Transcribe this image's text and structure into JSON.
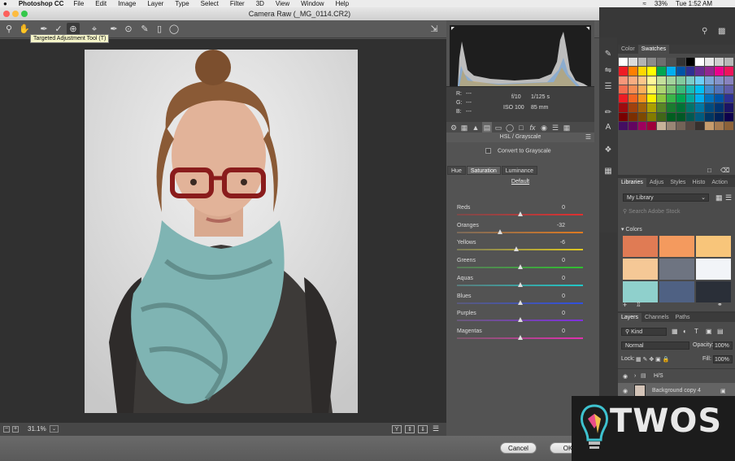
{
  "menubar": {
    "app": "Photoshop CC",
    "items": [
      "File",
      "Edit",
      "Image",
      "Layer",
      "Type",
      "Select",
      "Filter",
      "3D",
      "View",
      "Window",
      "Help"
    ],
    "battery": "33%",
    "clock": "Tue 1:52 AM"
  },
  "window": {
    "title": "Camera Raw (_MG_0114.CR2)"
  },
  "toolbar": {
    "tooltip": "Targeted Adjustment Tool (T)"
  },
  "zoom": {
    "value": "31.1%"
  },
  "buttons": {
    "cancel": "Cancel",
    "ok": "OK"
  },
  "info": {
    "r_label": "R:",
    "g_label": "G:",
    "b_label": "B:",
    "r": "---",
    "g": "---",
    "b": "---",
    "aperture": "f/10",
    "shutter": "1/125 s",
    "iso": "ISO 100",
    "focal": "85 mm"
  },
  "hsl": {
    "title": "HSL / Grayscale",
    "convert_label": "Convert to Grayscale",
    "tabs": [
      "Hue",
      "Saturation",
      "Luminance"
    ],
    "selected_tab": "Saturation",
    "default_label": "Default",
    "sliders": [
      {
        "label": "Reds",
        "value": "0"
      },
      {
        "label": "Oranges",
        "value": "-32"
      },
      {
        "label": "Yellows",
        "value": "-6"
      },
      {
        "label": "Greens",
        "value": "0"
      },
      {
        "label": "Aquas",
        "value": "0"
      },
      {
        "label": "Blues",
        "value": "0"
      },
      {
        "label": "Purples",
        "value": "0"
      },
      {
        "label": "Magentas",
        "value": "0"
      }
    ]
  },
  "swatches": {
    "tabs": [
      "Color",
      "Swatches"
    ],
    "selected_tab": "Swatches",
    "colors": [
      "#ffffff",
      "#dcdcdc",
      "#b4b4b4",
      "#8c8c8c",
      "#6e6e6e",
      "#505050",
      "#323232",
      "#000000",
      "#ffffff",
      "#e8e8e8",
      "#d0d0d0",
      "#b8b8b8",
      "#ee1c24",
      "#ff7f00",
      "#ffd700",
      "#ffff00",
      "#00a651",
      "#00aeef",
      "#0054a6",
      "#2e3192",
      "#662d91",
      "#92278f",
      "#ec008c",
      "#ed145b",
      "#f7977a",
      "#f9ad81",
      "#fdc68a",
      "#fff79a",
      "#c4df9b",
      "#a3d39c",
      "#82ca9d",
      "#7bcdc8",
      "#6ecff6",
      "#7ea7d8",
      "#8493ca",
      "#8882be",
      "#f26c4f",
      "#f68e55",
      "#fbaf5c",
      "#fff467",
      "#acd372",
      "#7cc576",
      "#3bb878",
      "#1abbb4",
      "#00bff3",
      "#438ccb",
      "#5574b9",
      "#605ca8",
      "#ed1c24",
      "#f26522",
      "#f7941d",
      "#fff200",
      "#8dc73f",
      "#39b54a",
      "#00a651",
      "#00a99d",
      "#00aeef",
      "#0072bc",
      "#0054a6",
      "#2e3192",
      "#9e0b0f",
      "#a0410d",
      "#a36209",
      "#aba000",
      "#598527",
      "#1a7b30",
      "#007236",
      "#00746b",
      "#0076a3",
      "#004b80",
      "#003471",
      "#1b1464",
      "#790000",
      "#7b2e00",
      "#7d4900",
      "#827b00",
      "#406618",
      "#005e20",
      "#005826",
      "#005952",
      "#005b7f",
      "#003663",
      "#002157",
      "#0d004c",
      "#440e62",
      "#630460",
      "#9e005d",
      "#9e0039",
      "#c7b299",
      "#998675",
      "#736357",
      "#534741",
      "#37302d",
      "#c69c6d",
      "#a67c52",
      "#8c6239"
    ]
  },
  "libraries": {
    "tabs": [
      "Libraries",
      "Adjus",
      "Styles",
      "Histo",
      "Action"
    ],
    "selected_tab": "Libraries",
    "library": "My Library",
    "search_placeholder": "Search Adobe Stock",
    "colors_label": "Colors",
    "color_tiles": [
      "#e07b54",
      "#f49a5e",
      "#f8c57a",
      "#f5c896",
      "#6e7481",
      "#f2f4f8",
      "#8fd0cc",
      "#4f6183",
      "#2a2f38"
    ]
  },
  "layers": {
    "tabs": [
      "Layers",
      "Channels",
      "Paths"
    ],
    "selected_tab": "Layers",
    "kind": "Kind",
    "blend": "Normal",
    "opacity_label": "Opacity:",
    "opacity": "100%",
    "lock_label": "Lock:",
    "fill_label": "Fill:",
    "fill": "100%",
    "rows": [
      {
        "name": "H/S"
      },
      {
        "name": "Background copy 4"
      }
    ]
  },
  "watermark": {
    "text": "TWOS"
  }
}
